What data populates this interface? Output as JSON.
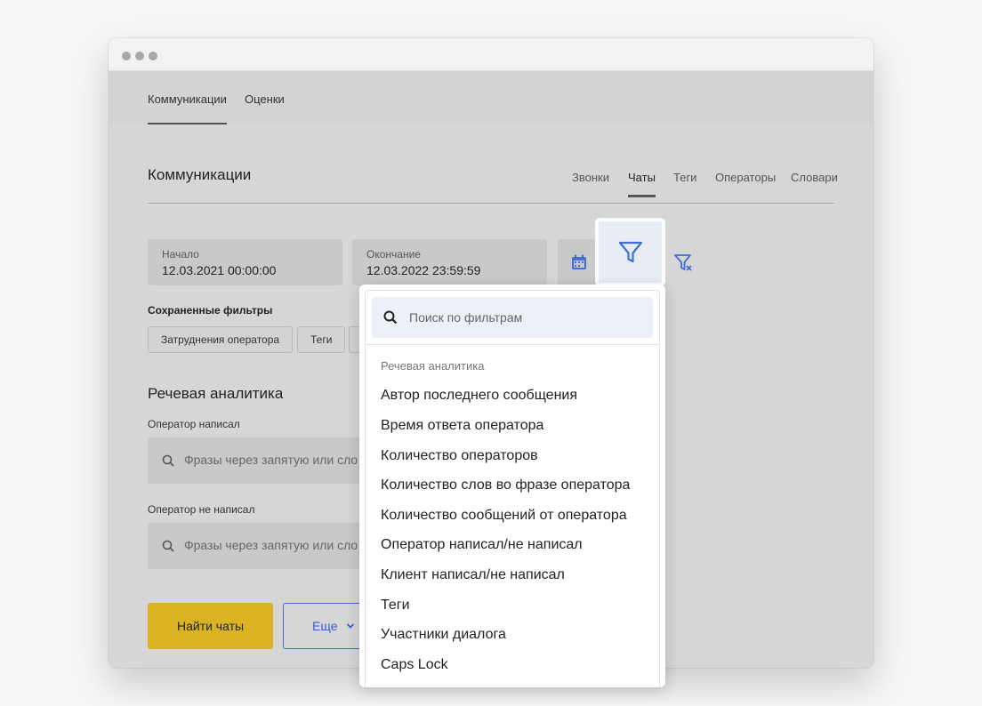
{
  "top_tabs": [
    "Коммуникации",
    "Оценки"
  ],
  "page": {
    "title": "Коммуникации",
    "sub_tabs": [
      "Звонки",
      "Чаты",
      "Теги",
      "Операторы",
      "Словари"
    ]
  },
  "dates": {
    "start_label": "Начало",
    "start_value": "12.03.2021 00:00:00",
    "end_label": "Окончание",
    "end_value": "12.03.2022 23:59:59"
  },
  "saved_filters": {
    "title": "Сохраненные фильтры",
    "chips": [
      "Затруднения оператора",
      "Теги"
    ]
  },
  "speech": {
    "title": "Речевая аналитика",
    "operator_wrote_label": "Оператор написал",
    "operator_not_wrote_label": "Оператор не написал",
    "placeholder": "Фразы через запятую или сло"
  },
  "buttons": {
    "find": "Найти чаты",
    "more": "Еще"
  },
  "filter_menu": {
    "search_placeholder": "Поиск по фильтрам",
    "group": "Речевая аналитика",
    "items": [
      "Автор последнего сообщения",
      "Время ответа оператора",
      "Количество операторов",
      "Количество слов во фразе оператора",
      "Количество сообщений от оператора",
      "Оператор написал/не написал",
      "Клиент написал/не написал",
      "Теги",
      "Участники диалога",
      "Caps Lock"
    ]
  },
  "colors": {
    "accent_blue": "#3d6fd6",
    "primary_yellow": "#d9b321",
    "overlay_gray": "#d6d6d6"
  }
}
